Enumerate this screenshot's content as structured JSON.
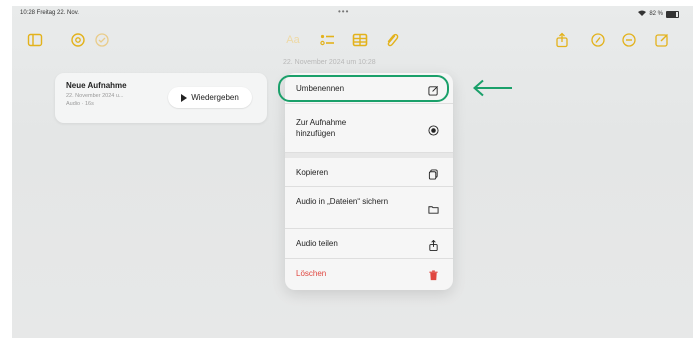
{
  "status_bar": {
    "time": "10:28  Freitag 22. Nov.",
    "dots": "•••",
    "battery": "82 %"
  },
  "toolbar": {
    "left_icons": [
      "sidebar-icon",
      "at-icon",
      "checkmark-circle-icon"
    ],
    "center_icons": [
      "text-format-icon",
      "checklist-icon",
      "table-icon",
      "paperclip-icon"
    ],
    "center_text_label": "Aa",
    "right_icons": [
      "share-icon",
      "markup-icon",
      "more-icon",
      "compose-icon"
    ],
    "accent_color": "#e3b21b"
  },
  "note": {
    "date_header": "22. November 2024 um 10:28"
  },
  "recording_card": {
    "title": "Neue Aufnahme",
    "meta_line1": "22. November 2024 u...",
    "meta_line2": "Audio · 16s",
    "play_label": "Wiedergeben"
  },
  "context_menu": {
    "items": [
      {
        "label": "Umbenennen",
        "icon": "rename-icon"
      },
      {
        "label": "Zur Aufnahme hinzufügen",
        "icon": "record-icon"
      },
      {
        "label": "Kopieren",
        "icon": "copy-icon"
      },
      {
        "label": "Audio in „Dateien“ sichern",
        "icon": "folder-icon"
      },
      {
        "label": "Audio teilen",
        "icon": "share-icon"
      },
      {
        "label": "Löschen",
        "icon": "trash-icon",
        "style": "destructive"
      }
    ],
    "destructive_color": "#e0463f"
  },
  "annotation": {
    "highlight_color": "#1aa06a",
    "arrow_icon": "left-arrow-icon"
  }
}
